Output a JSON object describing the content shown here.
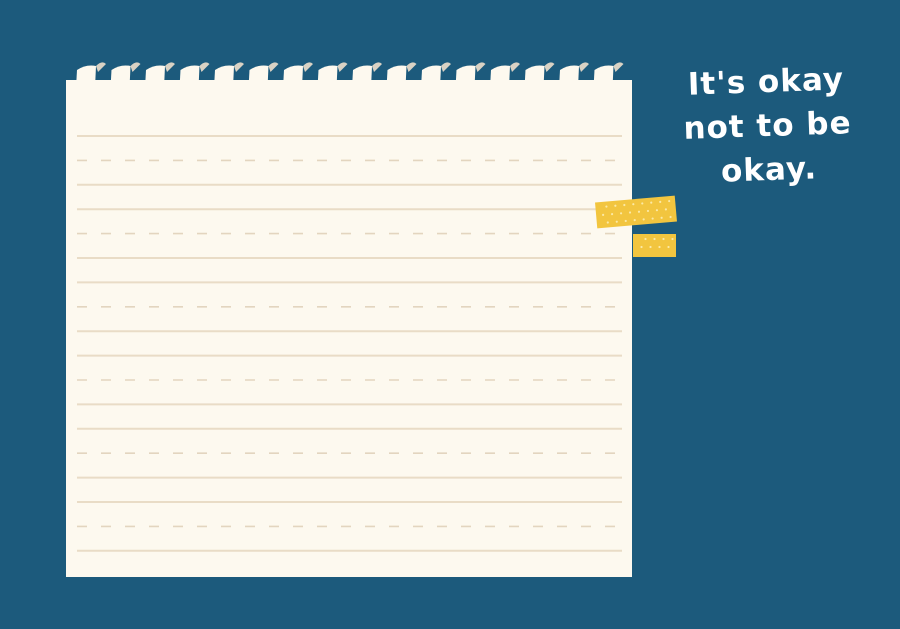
{
  "background_color": "#1c5a7c",
  "paper": {
    "color": "#fdf9ef",
    "solid_line_color": "#e9dcc6",
    "dashed_line_color": "#e3d5bf"
  },
  "tape": {
    "color": "#f2c53f",
    "dot_color": "#fbe9a6"
  },
  "quote": {
    "line1": "It's okay",
    "line2": "not to be",
    "line3": "okay."
  }
}
